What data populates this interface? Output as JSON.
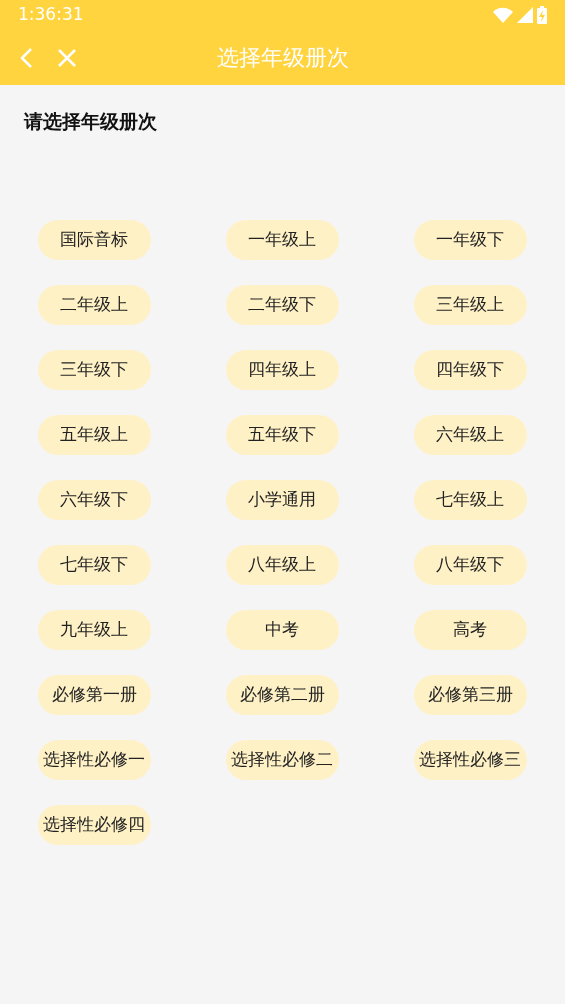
{
  "status_bar": {
    "time": "1:36:31"
  },
  "app_bar": {
    "title": "选择年级册次"
  },
  "heading": "请选择年级册次",
  "options": [
    "国际音标",
    "一年级上",
    "一年级下",
    "二年级上",
    "二年级下",
    "三年级上",
    "三年级下",
    "四年级上",
    "四年级下",
    "五年级上",
    "五年级下",
    "六年级上",
    "六年级下",
    "小学通用",
    "七年级上",
    "七年级下",
    "八年级上",
    "八年级下",
    "九年级上",
    "中考",
    "高考",
    "必修第一册",
    "必修第二册",
    "必修第三册",
    "选择性必修一",
    "选择性必修二",
    "选择性必修三",
    "选择性必修四"
  ]
}
